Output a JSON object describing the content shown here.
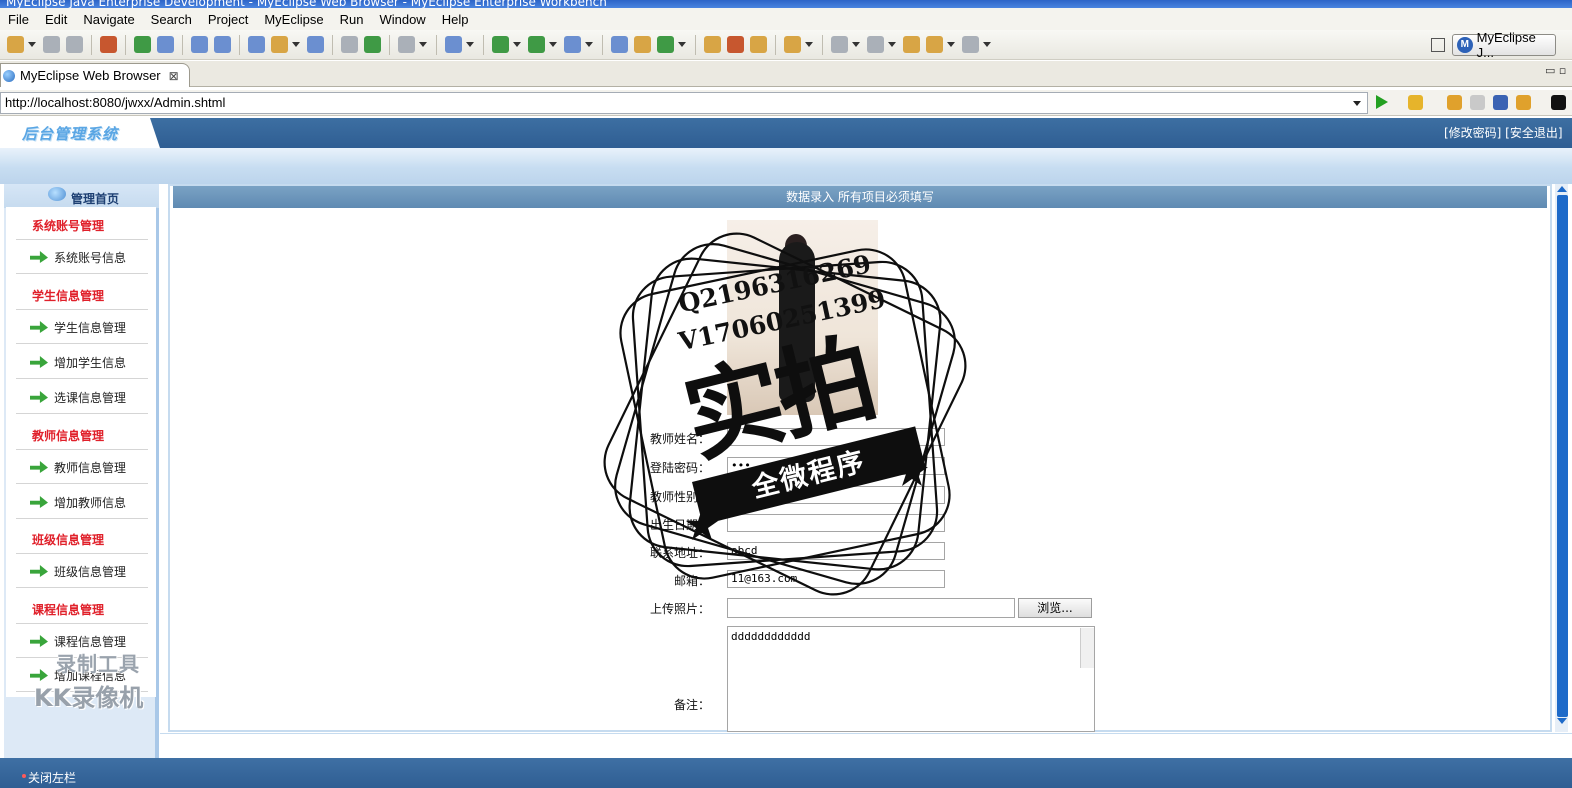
{
  "window": {
    "title": "MyEclipse Java Enterprise Development - MyEclipse Web Browser - MyEclipse Enterprise Workbench"
  },
  "menubar": [
    "File",
    "Edit",
    "Navigate",
    "Search",
    "Project",
    "MyEclipse",
    "Run",
    "Window",
    "Help"
  ],
  "perspective": {
    "label": "MyEclipse J..."
  },
  "editor_tab": {
    "label": "MyEclipse Web Browser",
    "close": "⊠"
  },
  "view_controls": "▭ ▫",
  "browser": {
    "url": "http://localhost:8080/jwxx/Admin.shtml"
  },
  "app": {
    "logo": "后台管理系统",
    "header_links": "[修改密码] [安全退出]",
    "home_label": "管理首页",
    "footer_link": "关闭左栏"
  },
  "sidebar": {
    "cat_account": "系统账号管理",
    "item_account_info": "系统账号信息",
    "cat_student": "学生信息管理",
    "item_student_manage": "学生信息管理",
    "item_student_add": "增加学生信息",
    "item_course_select": "选课信息管理",
    "cat_teacher": "教师信息管理",
    "item_teacher_manage": "教师信息管理",
    "item_teacher_add": "增加教师信息",
    "cat_class": "班级信息管理",
    "item_class_manage": "班级信息管理",
    "cat_course": "课程信息管理",
    "item_course_manage": "课程信息管理",
    "item_course_add": "增加课程信息"
  },
  "form": {
    "header": "数据录入 所有项目必须填写",
    "name_label": "教师姓名：",
    "password_label": "登陆密码：",
    "password_value": "•••",
    "gender_label": "教师性别：",
    "birth_label": "出生日期：",
    "address_label": "联系地址：",
    "address_value": "abcd",
    "email_label": "邮箱：",
    "email_value": "11@163.com",
    "photo_label": "上传照片：",
    "browse_button": "浏览...",
    "remark_label": "备注：",
    "remark_value": "dddddddddddd"
  },
  "watermarks": {
    "recorder_line1": "录制工具",
    "recorder_line2": "KK录像机",
    "stamp_q": "Q2196316269",
    "stamp_v": "V17060251399",
    "stamp_big": "实拍",
    "stamp_banner": "全微程序"
  }
}
